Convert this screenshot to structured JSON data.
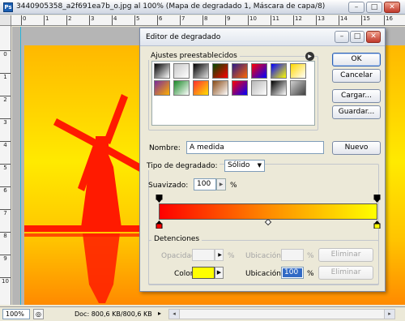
{
  "document": {
    "title": "3440905358_a2f691ea7b_o.jpg al 100% (Mapa de degradado 1, Máscara de capa/8)",
    "ruler_top": [
      "0",
      "1",
      "2",
      "3",
      "4",
      "5",
      "6",
      "7",
      "8",
      "9",
      "10",
      "11",
      "12",
      "13",
      "14",
      "15",
      "16",
      "17"
    ],
    "ruler_left": [
      "0",
      "1",
      "2",
      "3",
      "4",
      "5",
      "6",
      "7",
      "8",
      "9",
      "10",
      "11"
    ],
    "status": {
      "zoom": "100%",
      "doc_info": "Doc: 800,6 KB/800,6 KB"
    }
  },
  "dialog": {
    "title": "Editor de degradado",
    "presets": {
      "label": "Ajustes preestablecidos",
      "swatches": [
        [
          "#000000",
          "#ffffff"
        ],
        [
          "#c8c8c8",
          "#ffffff"
        ],
        [
          "#000000",
          "#e0e0e0"
        ],
        [
          "#004a00",
          "#ff0000"
        ],
        [
          "#2a1a8a",
          "#ff6600"
        ],
        [
          "#ff0000",
          "#0000ff"
        ],
        [
          "#0000ff",
          "#ffff00"
        ],
        [
          "#ffd700",
          "#ffffff"
        ],
        [
          "#7a2b9c",
          "#ffb000"
        ],
        [
          "#1c8a2a",
          "#ffffff"
        ],
        [
          "#ff3030",
          "#ffe000"
        ],
        [
          "#8a4b16",
          "#ffffff"
        ],
        [
          "#ff0000",
          "#0000ff"
        ],
        [
          "#b8b8b8",
          "#ffffff"
        ],
        [
          "#000000",
          "#ffffff"
        ],
        [
          "#d0d0d0",
          "#404040"
        ]
      ]
    },
    "buttons": {
      "ok": "OK",
      "cancel": "Cancelar",
      "load": "Cargar...",
      "save": "Guardar...",
      "new": "Nuevo"
    },
    "name": {
      "label": "Nombre:",
      "value": "A medida"
    },
    "gradient_type": {
      "label": "Tipo de degradado:",
      "value": "Sólido"
    },
    "smoothness": {
      "label": "Suavizado:",
      "value": "100",
      "unit": "%"
    },
    "gradient_colors": [
      "#ff0000",
      "#ff8a00",
      "#ffff00"
    ],
    "stops": {
      "legend": "Detenciones",
      "opacity_label": "Opacidad:",
      "opacity_unit": "%",
      "location_label_top": "Ubicación:",
      "location_unit_top": "%",
      "delete_top": "Eliminar",
      "color_label": "Color:",
      "stop_color": "#ffff00",
      "location_label": "Ubicación:",
      "location_value": "100",
      "location_unit": "%",
      "delete_bottom": "Eliminar"
    }
  }
}
